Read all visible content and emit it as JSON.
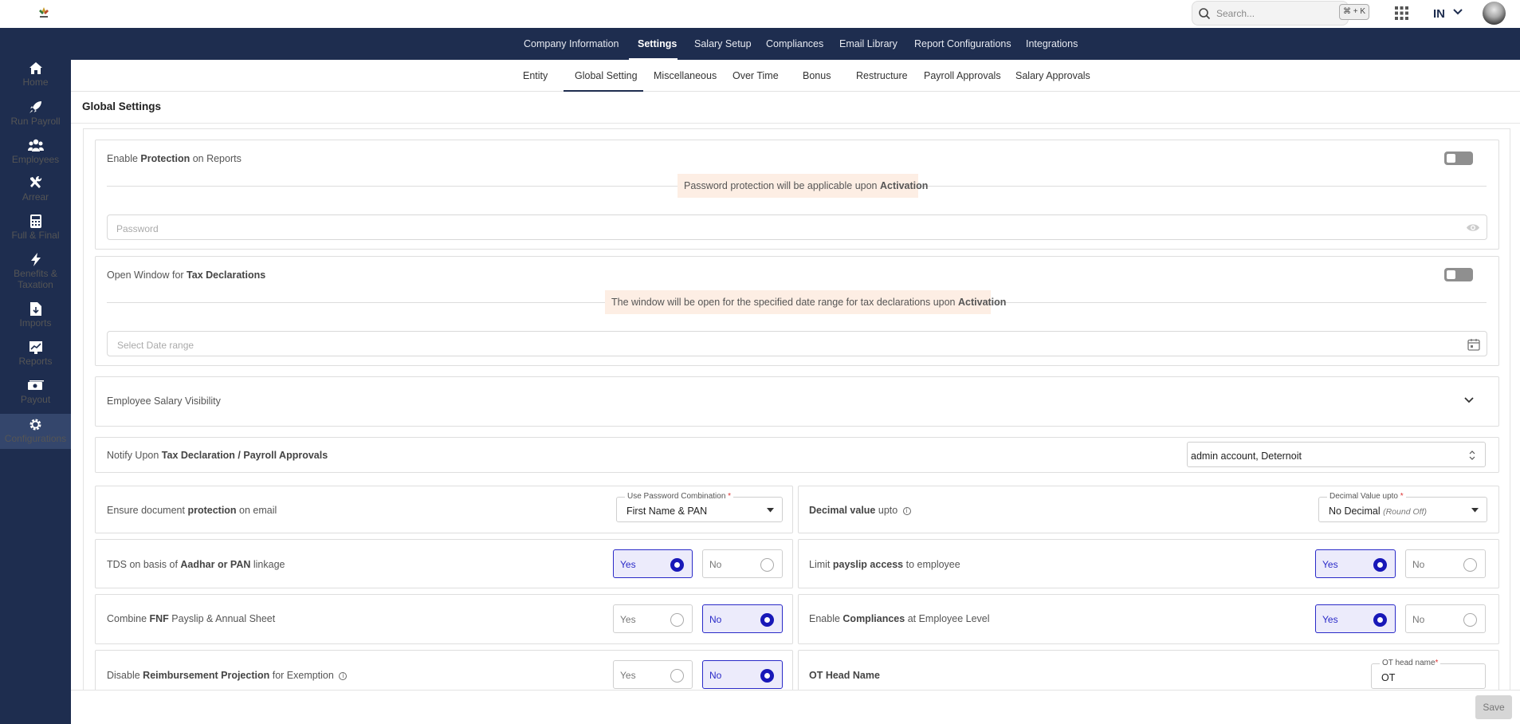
{
  "header": {
    "search_placeholder": "Search...",
    "shortcut": "⌘ + K",
    "country": "IN"
  },
  "main_nav": [
    {
      "label": "Company Information"
    },
    {
      "label": "Settings",
      "active": true
    },
    {
      "label": "Salary Setup"
    },
    {
      "label": "Compliances"
    },
    {
      "label": "Email Library"
    },
    {
      "label": "Report Configurations"
    },
    {
      "label": "Integrations"
    }
  ],
  "sidebar": [
    {
      "label": "Home",
      "icon": "home-icon"
    },
    {
      "label": "Run Payroll",
      "icon": "rocket-icon"
    },
    {
      "label": "Employees",
      "icon": "users-icon"
    },
    {
      "label": "Arrear",
      "icon": "tools-icon"
    },
    {
      "label": "Full & Final",
      "icon": "calculator-icon"
    },
    {
      "label": "Benefits &",
      "label2": "Taxation",
      "icon": "bolt-icon"
    },
    {
      "label": "Imports",
      "icon": "file-import-icon"
    },
    {
      "label": "Reports",
      "icon": "chart-icon"
    },
    {
      "label": "Payout",
      "icon": "money-icon"
    },
    {
      "label": "Configurations",
      "icon": "gear-icon",
      "active": true
    }
  ],
  "sub_nav": [
    {
      "label": "Entity"
    },
    {
      "label": "Global Setting",
      "active": true
    },
    {
      "label": "Miscellaneous"
    },
    {
      "label": "Over Time"
    },
    {
      "label": "Bonus"
    },
    {
      "label": "Restructure"
    },
    {
      "label": "Payroll Approvals"
    },
    {
      "label": "Salary Approvals"
    }
  ],
  "page_title": "Global Settings",
  "protection": {
    "label_pre": "Enable ",
    "label_bold": "Protection",
    "label_post": " on Reports",
    "enabled": false,
    "notice_pre": "Password protection will be applicable upon ",
    "notice_bold": "Activation",
    "password_placeholder": "Password"
  },
  "tax_window": {
    "label_pre": "Open Window for ",
    "label_bold": "Tax Declarations",
    "enabled": false,
    "notice_pre": "The window will be open for the specified date range for tax declarations upon ",
    "notice_bold": "Activation",
    "date_placeholder": "Select Date range"
  },
  "salary_visibility": {
    "label": "Employee Salary Visibility"
  },
  "notify": {
    "label_pre": "Notify Upon ",
    "label_bold": "Tax Declaration / Payroll Approvals",
    "value": "admin account, Deternoit"
  },
  "doc_protection": {
    "label_pre": "Ensure document ",
    "label_bold": "protection",
    "label_post": " on email",
    "field_label": "Use Password Combination",
    "required": "*",
    "value": "First Name & PAN"
  },
  "decimal": {
    "label_bold": "Decimal value",
    "label_post": " upto",
    "field_label": "Decimal Value upto",
    "required": "*",
    "value": "No Decimal",
    "value_note": "(Round Off)"
  },
  "tds": {
    "label_pre": "TDS on basis of ",
    "label_bold": "Aadhar or PAN",
    "label_post": " linkage",
    "yes": "Yes",
    "no": "No",
    "selected": "yes"
  },
  "payslip_access": {
    "label_pre": "Limit ",
    "label_bold": "payslip access",
    "label_post": " to employee",
    "yes": "Yes",
    "no": "No",
    "selected": "yes"
  },
  "fnf": {
    "label_pre": "Combine ",
    "label_bold": "FNF",
    "label_post": " Payslip & Annual Sheet",
    "yes": "Yes",
    "no": "No",
    "selected": "no"
  },
  "compliances": {
    "label_pre": "Enable ",
    "label_bold": "Compliances",
    "label_post": " at Employee Level",
    "yes": "Yes",
    "no": "No",
    "selected": "yes"
  },
  "reimbursement": {
    "label_pre": "Disable ",
    "label_bold": "Reimbursement Projection",
    "label_post": " for Exemption",
    "yes": "Yes",
    "no": "No",
    "selected": "no"
  },
  "ot_head": {
    "label": "OT Head Name",
    "field_label": "OT head name",
    "required": "*",
    "value": "OT"
  },
  "save_label": "Save"
}
